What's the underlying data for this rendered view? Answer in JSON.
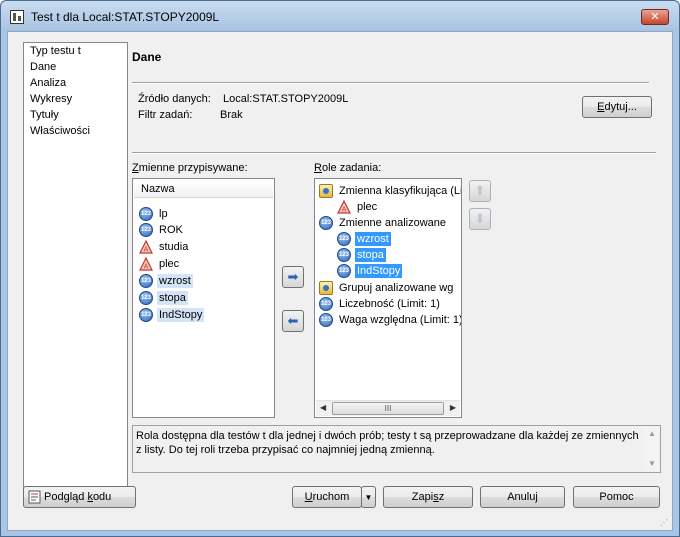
{
  "window": {
    "title": "Test t dla Local:STAT.STOPY2009L",
    "close_glyph": "✕"
  },
  "nav": {
    "items": [
      "Typ testu t",
      "Dane",
      "Analiza",
      "Wykresy",
      "Tytuły",
      "Właściwości"
    ]
  },
  "dane": {
    "heading": "Dane",
    "source_label": "Źródło danych:",
    "source_value": "Local:STAT.STOPY2009L",
    "filter_label": "Filtr zadań:",
    "filter_value": "Brak",
    "edit_button": {
      "pre": "",
      "accel": "E",
      "post": "dytuj..."
    }
  },
  "variables": {
    "label": {
      "pre": "",
      "accel": "Z",
      "post": "mienne przypisywane:"
    },
    "header": "Nazwa",
    "items": [
      {
        "name": "lp",
        "icon": "scale-icon"
      },
      {
        "name": "ROK",
        "icon": "scale-icon"
      },
      {
        "name": "studia",
        "icon": "nominal-icon"
      },
      {
        "name": "plec",
        "icon": "nominal-icon"
      },
      {
        "name": "wzrost",
        "icon": "scale-icon"
      },
      {
        "name": "stopa",
        "icon": "scale-icon"
      },
      {
        "name": "IndStopy",
        "icon": "scale-icon"
      }
    ]
  },
  "roles": {
    "label": {
      "pre": "",
      "accel": "R",
      "post": "ole zadania:"
    },
    "items": [
      {
        "text": "Zmienna klasyfikująca  (Li",
        "icon": "role-icon",
        "level": 0
      },
      {
        "text": "plec",
        "icon": "nominal-icon",
        "level": 1
      },
      {
        "text": "Zmienne analizowane",
        "icon": "scale-icon",
        "level": 0
      },
      {
        "text": "wzrost",
        "icon": "scale-icon",
        "level": 1,
        "highlight": true
      },
      {
        "text": "stopa",
        "icon": "scale-icon",
        "level": 1,
        "highlight": true
      },
      {
        "text": "IndStopy",
        "icon": "scale-icon",
        "level": 1,
        "highlight": true
      },
      {
        "text": "Grupuj analizowane wg",
        "icon": "role-icon",
        "level": 0
      },
      {
        "text": "Liczebność  (Limit: 1)",
        "icon": "scale-icon",
        "level": 0
      },
      {
        "text": "Waga względna  (Limit: 1)",
        "icon": "scale-icon",
        "level": 0
      }
    ],
    "scroll_thumb": "III"
  },
  "description": "Rola dostępna dla testów t dla jednej i dwóch prób; testy t są przeprowadzane dla każdej ze zmiennych z listy. Do tej roli trzeba przypisać co najmniej jedną zmienną.",
  "footer": {
    "preview": {
      "pre": "Podgląd ",
      "accel": "k",
      "post": "odu"
    },
    "run": {
      "pre": "",
      "accel": "U",
      "post": "ruchom"
    },
    "save": {
      "pre": "Zapi",
      "accel": "s",
      "post": "z"
    },
    "cancel": "Anuluj",
    "help": "Pomoc"
  }
}
